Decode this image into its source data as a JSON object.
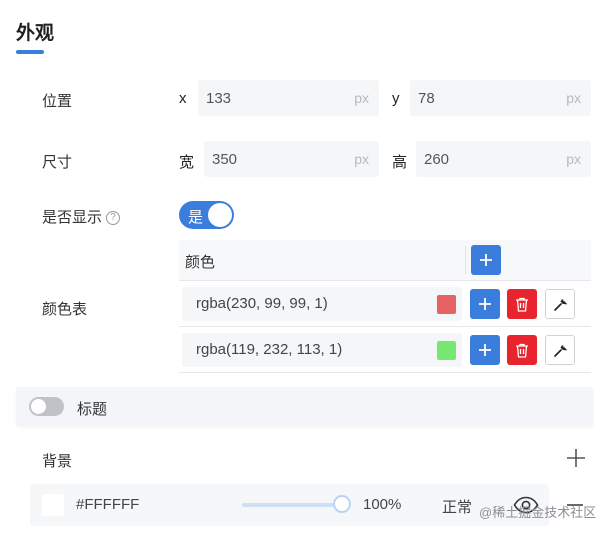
{
  "section": {
    "title": "外观"
  },
  "position": {
    "label": "位置",
    "x_label": "x",
    "x_value": "133",
    "y_label": "y",
    "y_value": "78",
    "unit": "px"
  },
  "size": {
    "label": "尺寸",
    "w_label": "宽",
    "w_value": "350",
    "h_label": "高",
    "h_value": "260",
    "unit": "px"
  },
  "visibility": {
    "label": "是否显示",
    "help_glyph": "?",
    "toggle_text": "是",
    "enabled": true
  },
  "color_table": {
    "label": "颜色表",
    "header": "颜色",
    "rows": [
      {
        "value": "rgba(230, 99, 99, 1)",
        "swatch": "#e66363"
      },
      {
        "value": "rgba(119, 232, 113, 1)",
        "swatch": "#77e871"
      }
    ]
  },
  "title_section": {
    "label": "标题",
    "enabled": false
  },
  "background": {
    "label": "背景",
    "color_hex": "#FFFFFF",
    "opacity": "100%",
    "opacity_fraction": 1.0,
    "blend_mode": "正常"
  },
  "watermark": "@稀土掘金技术社区",
  "colors": {
    "accent": "#3b7ddd",
    "danger": "#e8252f"
  },
  "icons": [
    "help-icon",
    "plus-icon",
    "trash-icon",
    "wrench-icon",
    "eye-icon",
    "minus-icon"
  ]
}
